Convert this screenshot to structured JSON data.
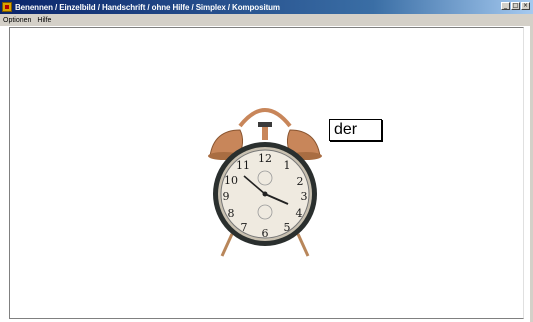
{
  "window": {
    "title": "Benennen / Einzelbild / Handschrift / ohne Hilfe / Simplex / Kompositum",
    "buttons": [
      "minimize",
      "maximize",
      "close"
    ]
  },
  "menu": {
    "items": [
      {
        "label": "Optionen"
      },
      {
        "label": "Hilfe"
      }
    ]
  },
  "stimulus": {
    "image": "alarm-clock",
    "answer_text": "der"
  },
  "colors": {
    "titlebar_start": "#0a246a",
    "titlebar_end": "#a6caf0",
    "clock_bell": "#c8865a",
    "clock_body": "#2a2f2e"
  }
}
